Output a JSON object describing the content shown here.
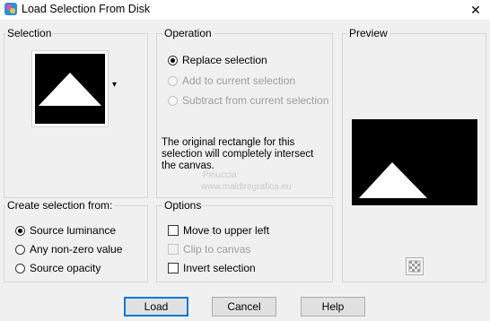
{
  "window": {
    "title": "Load Selection From Disk",
    "close_glyph": "✕",
    "app_icon": "psp-app-icon"
  },
  "selection": {
    "label": "Selection",
    "dropdown_glyph": "▾"
  },
  "operation": {
    "label": "Operation",
    "options": [
      {
        "label": "Replace selection",
        "checked": true,
        "enabled": true
      },
      {
        "label": "Add to current selection",
        "checked": false,
        "enabled": false
      },
      {
        "label": "Subtract from current selection",
        "checked": false,
        "enabled": false
      }
    ],
    "note": "The original rectangle for this selection will completely intersect the canvas."
  },
  "preview": {
    "label": "Preview",
    "button_icon": "checkerboard-icon"
  },
  "create_from": {
    "label": "Create selection from:",
    "options": [
      {
        "label": "Source luminance",
        "checked": true
      },
      {
        "label": "Any non-zero value",
        "checked": false
      },
      {
        "label": "Source opacity",
        "checked": false
      }
    ]
  },
  "options": {
    "label": "Options",
    "items": [
      {
        "label": "Move to upper left",
        "checked": false,
        "enabled": true
      },
      {
        "label": "Clip to canvas",
        "checked": false,
        "enabled": false
      },
      {
        "label": "Invert selection",
        "checked": false,
        "enabled": true
      }
    ]
  },
  "buttons": {
    "load": "Load",
    "cancel": "Cancel",
    "help": "Help"
  },
  "watermark": {
    "line1": "Pinuccia",
    "line2": "www.maldiregrafica.eu"
  }
}
